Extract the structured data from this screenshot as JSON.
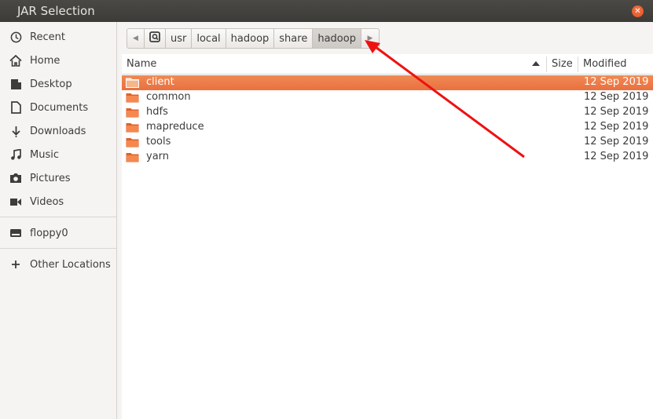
{
  "window": {
    "title": "JAR Selection"
  },
  "sidebar": {
    "items": [
      {
        "label": "Recent",
        "icon": "clock-icon"
      },
      {
        "label": "Home",
        "icon": "home-icon"
      },
      {
        "label": "Desktop",
        "icon": "desktop-icon"
      },
      {
        "label": "Documents",
        "icon": "document-icon"
      },
      {
        "label": "Downloads",
        "icon": "download-icon"
      },
      {
        "label": "Music",
        "icon": "music-icon"
      },
      {
        "label": "Pictures",
        "icon": "camera-icon"
      },
      {
        "label": "Videos",
        "icon": "video-icon"
      }
    ],
    "devices": [
      {
        "label": "floppy0",
        "icon": "drive-icon"
      }
    ],
    "other": {
      "label": "Other Locations",
      "icon": "plus-icon"
    }
  },
  "pathbar": {
    "segments": [
      "usr",
      "local",
      "hadoop",
      "share",
      "hadoop"
    ],
    "active_index": 4
  },
  "filelist": {
    "columns": {
      "name": "Name",
      "size": "Size",
      "modified": "Modified"
    },
    "rows": [
      {
        "name": "client",
        "size": "",
        "modified": "12 Sep 2019",
        "selected": true
      },
      {
        "name": "common",
        "size": "",
        "modified": "12 Sep 2019"
      },
      {
        "name": "hdfs",
        "size": "",
        "modified": "12 Sep 2019"
      },
      {
        "name": "mapreduce",
        "size": "",
        "modified": "12 Sep 2019"
      },
      {
        "name": "tools",
        "size": "",
        "modified": "12 Sep 2019"
      },
      {
        "name": "yarn",
        "size": "",
        "modified": "12 Sep 2019"
      }
    ]
  },
  "colors": {
    "selection": "#e9703f",
    "titlebar": "#3c3b37",
    "close": "#e0501f",
    "annotation_arrow": "#ee1111"
  }
}
